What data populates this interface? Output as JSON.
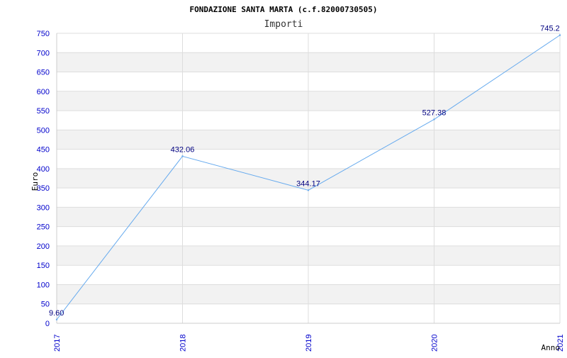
{
  "chart_data": {
    "type": "line",
    "title": "FONDAZIONE SANTA MARTA (c.f.82000730505)",
    "subtitle": "Importi",
    "xlabel": "Anno",
    "ylabel": "Euro",
    "categories": [
      "2017",
      "2018",
      "2019",
      "2020",
      "2021"
    ],
    "series": [
      {
        "values": [
          9.6,
          432.06,
          344.17,
          527.38,
          745.2
        ],
        "labels": [
          "9.60",
          "432.06",
          "344.17",
          "527.38",
          "745.2"
        ]
      }
    ],
    "ylim": [
      0,
      750
    ],
    "yticks": [
      "0",
      "50",
      "100",
      "150",
      "200",
      "250",
      "300",
      "350",
      "400",
      "450",
      "500",
      "550",
      "600",
      "650",
      "700",
      "750"
    ],
    "grid": true,
    "colors": {
      "line": "#66aaee",
      "band": "#f2f2f2",
      "grid": "#dddddd",
      "tick_text": "#0000cc",
      "value_text": "#000080"
    }
  }
}
